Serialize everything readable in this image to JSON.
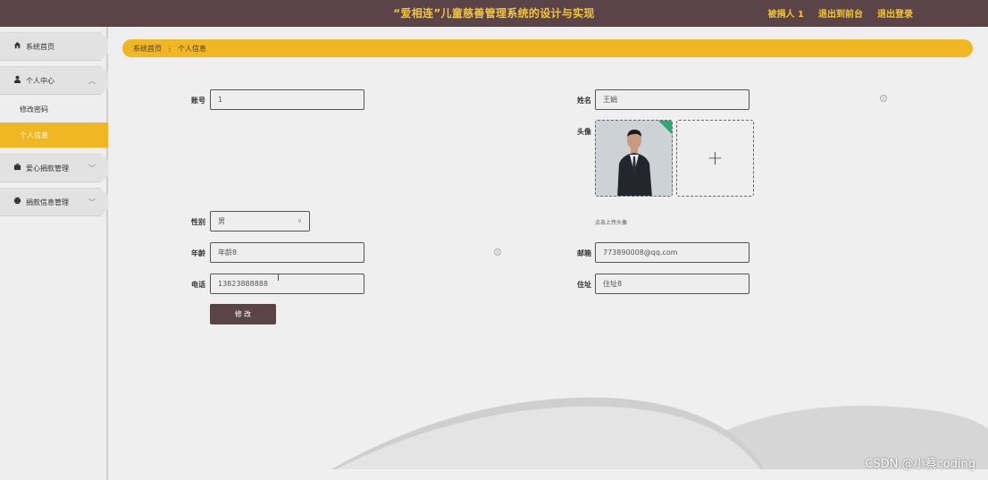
{
  "header": {
    "title": "“爱相连”儿童慈善管理系统的设计与实现",
    "links": [
      {
        "label": "被捐人 1"
      },
      {
        "label": "退出到前台"
      },
      {
        "label": "退出登录"
      }
    ]
  },
  "sidebar": {
    "items": [
      {
        "label": "系统首页",
        "icon": "home-icon"
      },
      {
        "label": "个人中心",
        "icon": "user-icon"
      },
      {
        "label": "修改密码"
      },
      {
        "label": "个人信息"
      },
      {
        "label": "爱心捐款管理",
        "icon": "briefcase-icon"
      },
      {
        "label": "捐款信息管理",
        "icon": "printer-icon"
      }
    ]
  },
  "breadcrumb": {
    "home": "系统首页",
    "separator": "⋮",
    "current": "个人信息"
  },
  "form": {
    "account": {
      "label": "账号",
      "value": "1"
    },
    "name": {
      "label": "姓名",
      "value": "王娟"
    },
    "avatar": {
      "label": "头像",
      "hint": "点击上传头像",
      "upload_glyph": "+"
    },
    "gender": {
      "label": "性别",
      "value": "男"
    },
    "age": {
      "label": "年龄",
      "value": "年龄8"
    },
    "email": {
      "label": "邮箱",
      "value": "773890008@qq.com"
    },
    "phone": {
      "label": "电话",
      "value": "13823888888"
    },
    "address": {
      "label": "住址",
      "value": "住址8"
    },
    "submit_label": "修 改"
  },
  "watermark": "CSDN @小蔡coding",
  "colors": {
    "header_bg": "#5a4448",
    "accent": "#f0b722",
    "title_color": "#f2c53d"
  }
}
